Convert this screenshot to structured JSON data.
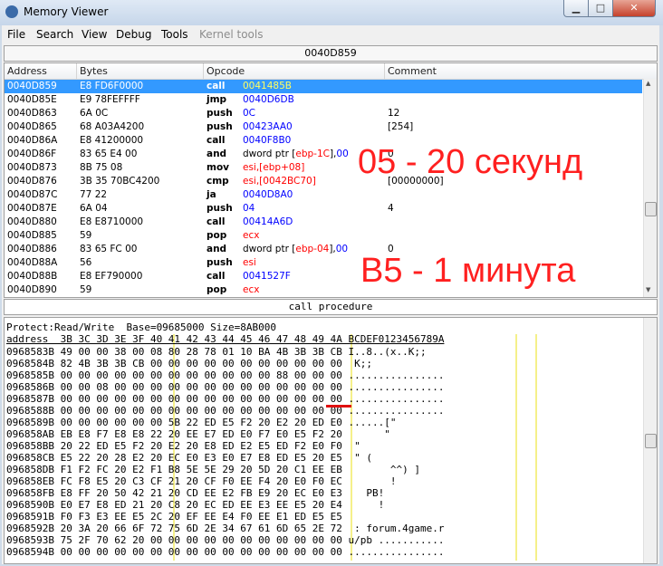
{
  "window": {
    "title": "Memory Viewer",
    "min_glyph": "▁",
    "max_glyph": "□",
    "close_glyph": "✕"
  },
  "menu": [
    {
      "label": "File",
      "enabled": true
    },
    {
      "label": "Search",
      "enabled": true
    },
    {
      "label": "View",
      "enabled": true
    },
    {
      "label": "Debug",
      "enabled": true
    },
    {
      "label": "Tools",
      "enabled": true
    },
    {
      "label": "Kernel tools",
      "enabled": false
    }
  ],
  "address_bar": "0040D859",
  "disasm": {
    "columns": [
      "Address",
      "Bytes",
      "Opcode",
      "Comment"
    ],
    "rows": [
      {
        "address": "0040D859",
        "bytes": "E8 FD6F0000",
        "op": "call",
        "arg": [
          {
            "t": "0041485B",
            "c": "b"
          }
        ],
        "comment": "",
        "selected": true
      },
      {
        "address": "0040D85E",
        "bytes": "E9 78FEFFFF",
        "op": "jmp",
        "arg": [
          {
            "t": "0040D6DB",
            "c": "b"
          }
        ],
        "comment": ""
      },
      {
        "address": "0040D863",
        "bytes": "6A 0C",
        "op": "push",
        "arg": [
          {
            "t": "0C",
            "c": "b"
          }
        ],
        "comment": "12"
      },
      {
        "address": "0040D865",
        "bytes": "68 A03A4200",
        "op": "push",
        "arg": [
          {
            "t": "00423AA0",
            "c": "b"
          }
        ],
        "comment": "[254]"
      },
      {
        "address": "0040D86A",
        "bytes": "E8 41200000",
        "op": "call",
        "arg": [
          {
            "t": "0040F8B0",
            "c": "b"
          }
        ],
        "comment": ""
      },
      {
        "address": "0040D86F",
        "bytes": "83 65 E4 00",
        "op": "and",
        "arg": [
          {
            "t": "dword ptr [",
            "c": "k"
          },
          {
            "t": "ebp-1C",
            "c": "r"
          },
          {
            "t": "],",
            "c": "k"
          },
          {
            "t": "00",
            "c": "b"
          }
        ],
        "comment": "0"
      },
      {
        "address": "0040D873",
        "bytes": "8B 75 08",
        "op": "mov",
        "arg": [
          {
            "t": "esi,[ebp+08]",
            "c": "r"
          }
        ],
        "comment": ""
      },
      {
        "address": "0040D876",
        "bytes": "3B 35 70BC4200",
        "op": "cmp",
        "arg": [
          {
            "t": "esi,[0042BC70]",
            "c": "r"
          }
        ],
        "comment": "[00000000]"
      },
      {
        "address": "0040D87C",
        "bytes": "77 22",
        "op": "ja",
        "arg": [
          {
            "t": "0040D8A0",
            "c": "b"
          }
        ],
        "comment": ""
      },
      {
        "address": "0040D87E",
        "bytes": "6A 04",
        "op": "push",
        "arg": [
          {
            "t": "04",
            "c": "b"
          }
        ],
        "comment": "4"
      },
      {
        "address": "0040D880",
        "bytes": "E8 E8710000",
        "op": "call",
        "arg": [
          {
            "t": "00414A6D",
            "c": "b"
          }
        ],
        "comment": ""
      },
      {
        "address": "0040D885",
        "bytes": "59",
        "op": "pop",
        "arg": [
          {
            "t": "ecx",
            "c": "r"
          }
        ],
        "comment": ""
      },
      {
        "address": "0040D886",
        "bytes": "83 65 FC 00",
        "op": "and",
        "arg": [
          {
            "t": "dword ptr [",
            "c": "k"
          },
          {
            "t": "ebp-04",
            "c": "r"
          },
          {
            "t": "],",
            "c": "k"
          },
          {
            "t": "00",
            "c": "b"
          }
        ],
        "comment": "0"
      },
      {
        "address": "0040D88A",
        "bytes": "56",
        "op": "push",
        "arg": [
          {
            "t": "esi",
            "c": "r"
          }
        ],
        "comment": ""
      },
      {
        "address": "0040D88B",
        "bytes": "E8 EF790000",
        "op": "call",
        "arg": [
          {
            "t": "0041527F",
            "c": "b"
          }
        ],
        "comment": ""
      },
      {
        "address": "0040D890",
        "bytes": "59",
        "op": "pop",
        "arg": [
          {
            "t": "ecx",
            "c": "r"
          }
        ],
        "comment": ""
      }
    ]
  },
  "overlays": {
    "line1": "05 - 20 секунд",
    "line2": "B5 - 1 минута"
  },
  "status_text": "call procedure",
  "hex": {
    "protect_line": "Protect:Read/Write  Base=09685000 Size=8AB000",
    "header": "address  3B 3C 3D 3E 3F 40 41 42 43 44 45 46 47 48 49 4A BCDEF0123456789A",
    "rows": [
      "0968583B 49 00 00 38 00 08 80 28 78 01 10 BA 4B 3B 3B CB I..8..(x..K;;",
      "0968584B 82 4B 3B 3B CB 00 00 00 00 00 00 00 00 00 00 00  K;;",
      "0968585B 00 00 00 00 00 00 00 00 00 00 00 00 88 00 00 00 ................",
      "0968586B 00 00 08 00 00 00 00 00 00 00 00 00 00 00 00 00 ................",
      "0968587B 00 00 00 00 00 00 00 00 00 00 00 00 00 00 00 00 ................",
      "0968588B 00 00 00 00 00 00 00 00 00 00 00 00 00 00 00 00 ................",
      "0968589B 00 00 00 00 00 00 5B 22 ED E5 F2 20 E2 20 ED E0 ......[\"",
      "096858AB EB E8 F7 E8 E8 22 20 EE E7 ED E0 F7 E0 E5 F2 20       \"",
      "096858BB 20 22 ED E5 F2 20 E2 20 E8 ED E2 E5 ED F2 E0 F0  \"",
      "096858CB E5 22 20 28 E2 20 EC E0 E3 E0 E7 E8 ED E5 20 E5  \" (",
      "096858DB F1 F2 FC 20 E2 F1 B8 5E 5E 29 20 5D 20 C1 EE EB        ^^) ]",
      "096858EB FC F8 E5 20 C3 CF 21 20 CF F0 EE F4 20 E0 F0 EC        !",
      "096858FB E8 FF 20 50 42 21 20 CD EE E2 FB E9 20 EC E0 E3    PB!",
      "0968590B E0 E7 E8 ED 21 20 C8 20 EC ED EE E3 EE E5 20 E4      !",
      "0968591B F0 F3 E3 EE E5 2C 20 EF EE E4 F0 EE E1 ED E5 E5",
      "0968592B 20 3A 20 66 6F 72 75 6D 2E 34 67 61 6D 65 2E 72  : forum.4game.r",
      "0968593B 75 2F 70 62 20 00 00 00 00 00 00 00 00 00 00 00 u/pb ...........",
      "0968594B 00 00 00 00 00 00 00 00 00 00 00 00 00 00 00 00 ................"
    ]
  }
}
